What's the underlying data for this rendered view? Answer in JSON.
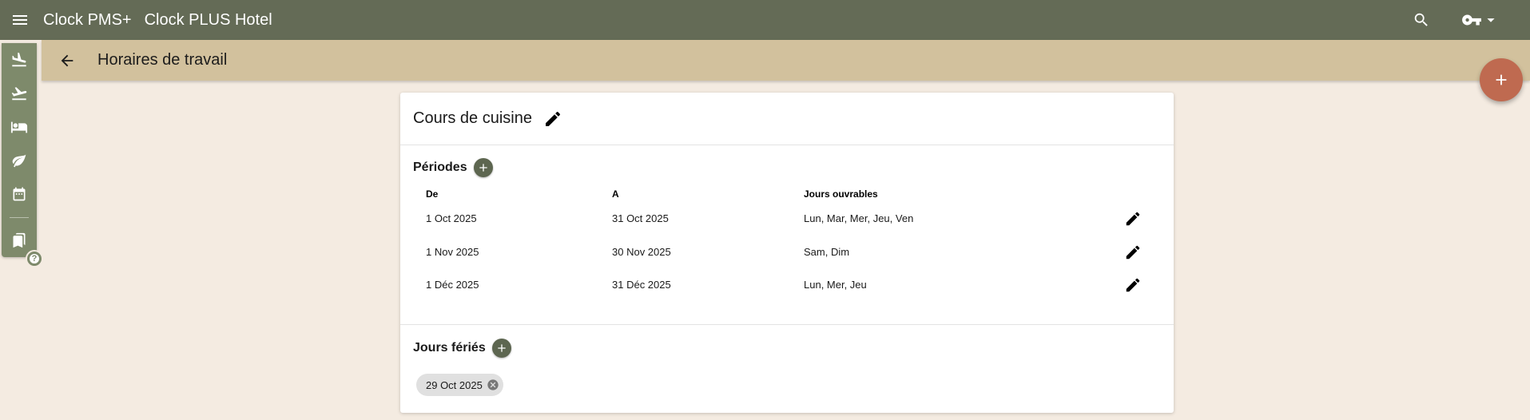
{
  "app": {
    "name": "Clock PMS+",
    "hotel": "Clock PLUS Hotel"
  },
  "header": {
    "icons": [
      "menu-icon",
      "search-icon",
      "key-icon",
      "arrow-drop-down-icon"
    ]
  },
  "subheader": {
    "title": "Horaires de travail",
    "back_icon": "arrow-back-icon"
  },
  "fab": {
    "icon": "add-icon",
    "color": "#bf6a50"
  },
  "rail": {
    "items": [
      {
        "icon": "flight-land-icon"
      },
      {
        "icon": "flight-takeoff-icon"
      },
      {
        "icon": "bed-icon"
      },
      {
        "icon": "leaf-icon"
      },
      {
        "icon": "calendar-icon"
      },
      {
        "icon": "bookmarks-icon"
      }
    ],
    "help_icon": "help-icon"
  },
  "card": {
    "title": "Cours de cuisine",
    "periods": {
      "title": "Périodes",
      "columns": [
        "De",
        "A",
        "Jours ouvrables"
      ],
      "rows": [
        {
          "from": "1 Oct 2025",
          "to": "31 Oct 2025",
          "days": "Lun, Mar, Mer, Jeu, Ven"
        },
        {
          "from": "1 Nov 2025",
          "to": "30 Nov 2025",
          "days": "Sam, Dim"
        },
        {
          "from": "1 Déc 2025",
          "to": "31 Déc 2025",
          "days": "Lun, Mer, Jeu"
        }
      ]
    },
    "holidays": {
      "title": "Jours fériés",
      "chips": [
        "29 Oct 2025"
      ]
    }
  },
  "colors": {
    "topbar": "#646b56",
    "subbar": "#d2c19d",
    "rail": "#7e8a6b",
    "background": "#f4ebe1",
    "accent_fab": "#bf6a50",
    "mini_fab": "#5d6650"
  }
}
